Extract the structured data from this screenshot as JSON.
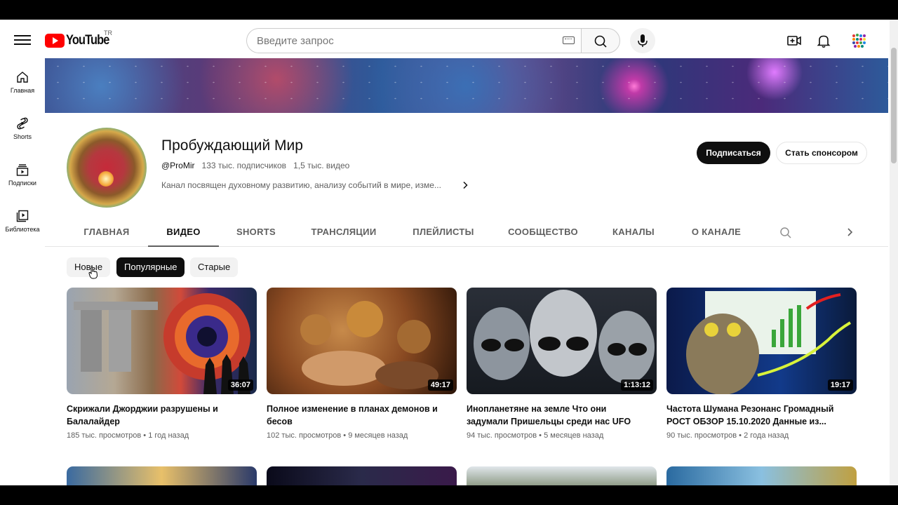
{
  "masthead": {
    "logo_text": "YouTube",
    "country_code": "TR",
    "search_placeholder": "Введите запрос",
    "icons": [
      "menu-icon",
      "keyboard-icon",
      "search-icon",
      "mic-icon",
      "create-icon",
      "bell-icon",
      "avatar-icon"
    ]
  },
  "sidebar": {
    "items": [
      {
        "label": "Главная",
        "icon": "home-icon"
      },
      {
        "label": "Shorts",
        "icon": "shorts-icon"
      },
      {
        "label": "Подписки",
        "icon": "subscriptions-icon"
      },
      {
        "label": "Библиотека",
        "icon": "library-icon"
      }
    ]
  },
  "channel": {
    "name": "Пробуждающий Мир",
    "handle": "@ProMir",
    "subscribers": "133 тыс. подписчиков",
    "videos": "1,5 тыс. видео",
    "description": "Канал посвящен духовному развитию, анализу событий в мире, изме...",
    "subscribe_label": "Подписаться",
    "sponsor_label": "Стать спонсором"
  },
  "tabs": [
    {
      "label": "ГЛАВНАЯ",
      "active": false
    },
    {
      "label": "ВИДЕО",
      "active": true
    },
    {
      "label": "SHORTS",
      "active": false
    },
    {
      "label": "ТРАНСЛЯЦИИ",
      "active": false
    },
    {
      "label": "ПЛЕЙЛИСТЫ",
      "active": false
    },
    {
      "label": "СООБЩЕСТВО",
      "active": false
    },
    {
      "label": "КАНАЛЫ",
      "active": false
    },
    {
      "label": "О КАНАЛЕ",
      "active": false
    }
  ],
  "chips": [
    {
      "label": "Новые",
      "active": false
    },
    {
      "label": "Популярные",
      "active": true
    },
    {
      "label": "Старые",
      "active": false
    }
  ],
  "videos": [
    {
      "title": "Скрижали Джорджии разрушены и Балалайдер",
      "duration": "36:07",
      "views": "185 тыс. просмотров",
      "age": "1 год назад"
    },
    {
      "title": "Полное изменение в планах демонов и бесов",
      "duration": "49:17",
      "views": "102 тыс. просмотров",
      "age": "9 месяцев назад"
    },
    {
      "title": "Инопланетяне на земле Что они задумали Пришельцы среди нас UFO",
      "duration": "1:13:12",
      "views": "94 тыс. просмотров",
      "age": "5 месяцев назад"
    },
    {
      "title": "Частота Шумана Резонанс Громадный РОСТ ОБЗОР 15.10.2020 Данные из...",
      "duration": "19:17",
      "views": "90 тыс. просмотров",
      "age": "2 года назад"
    }
  ],
  "colors": {
    "brand_red": "#ff0000",
    "text_primary": "#0f0f0f",
    "text_secondary": "#606060",
    "chip_bg": "#f2f2f2"
  }
}
